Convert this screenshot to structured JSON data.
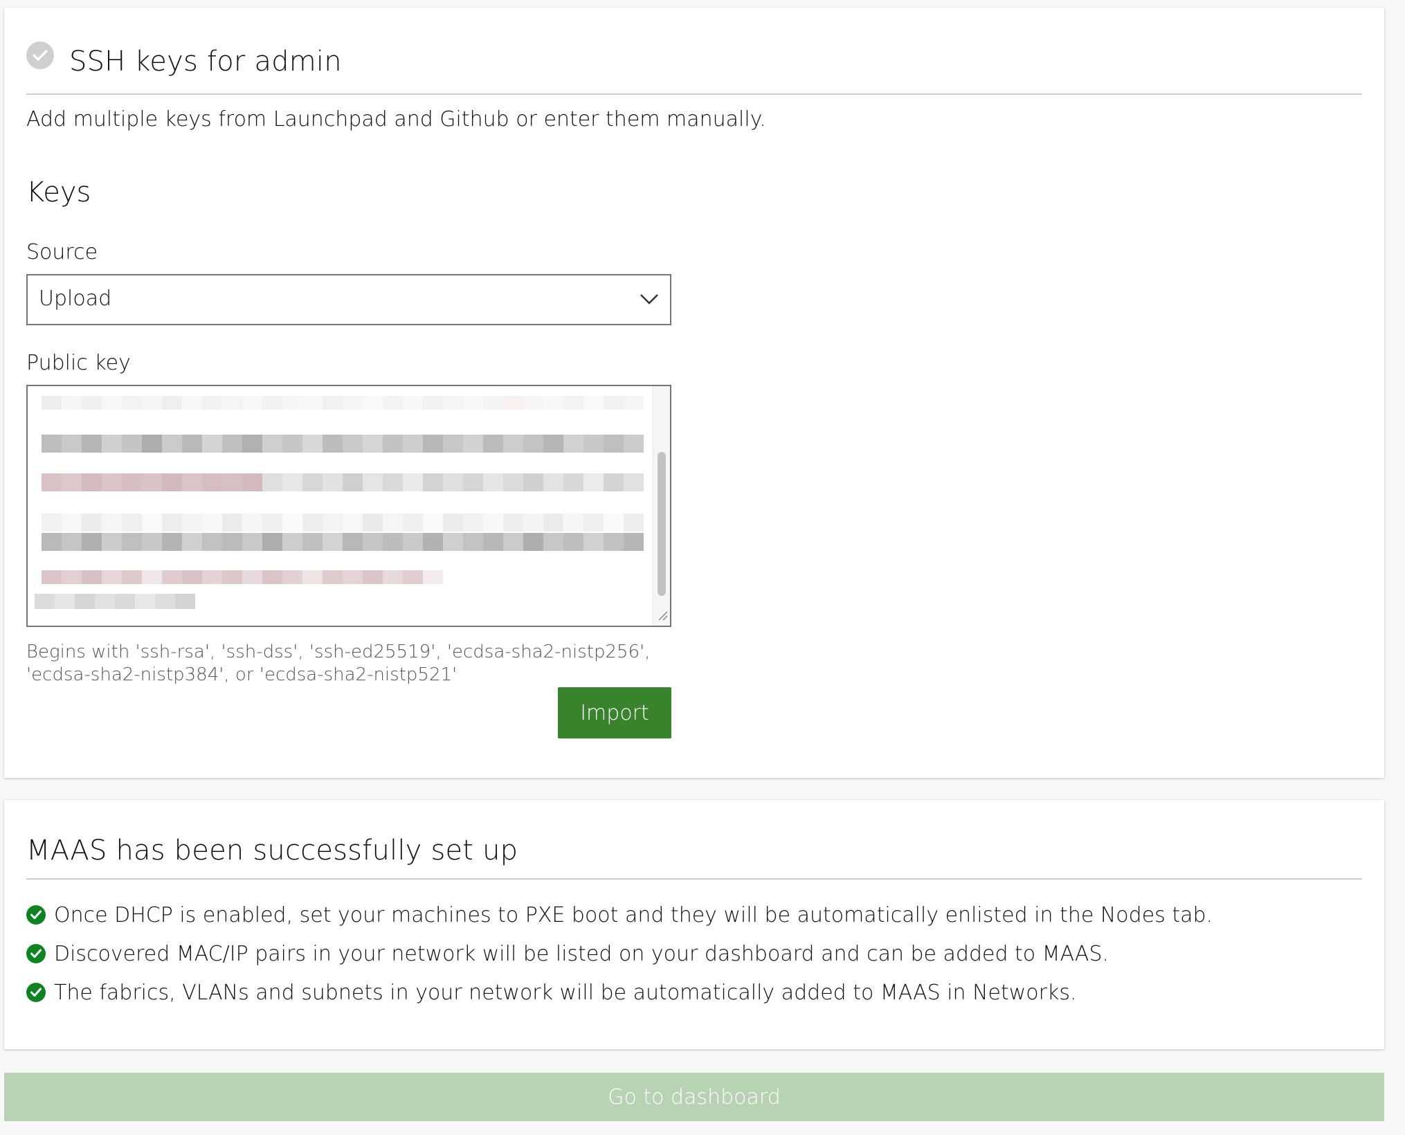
{
  "ssh_card": {
    "title": "SSH keys for admin",
    "intro": "Add multiple keys from Launchpad and Github or enter them manually.",
    "section_title": "Keys",
    "source_label": "Source",
    "source_value": "Upload",
    "public_key_label": "Public key",
    "help_text": "Begins with 'ssh-rsa', 'ssh-dss', 'ssh-ed25519', 'ecdsa-sha2-nistp256', 'ecdsa-sha2-nistp384', or 'ecdsa-sha2-nistp521'",
    "import_label": "Import"
  },
  "success_card": {
    "title": "MAAS has been successfully set up",
    "items": [
      "Once DHCP is enabled, set your machines to PXE boot and they will be automatically enlisted in the Nodes tab.",
      "Discovered MAC/IP pairs in your network will be listed on your dashboard and can be added to MAAS.",
      "The fabrics, VLANs and subnets in your network will be automatically added to MAAS in Networks."
    ]
  },
  "footer": {
    "dashboard_label": "Go to dashboard"
  },
  "colors": {
    "primary_button": "#38832b",
    "success_icon": "#0e8420",
    "disabled_button": "#b8d3b4"
  }
}
